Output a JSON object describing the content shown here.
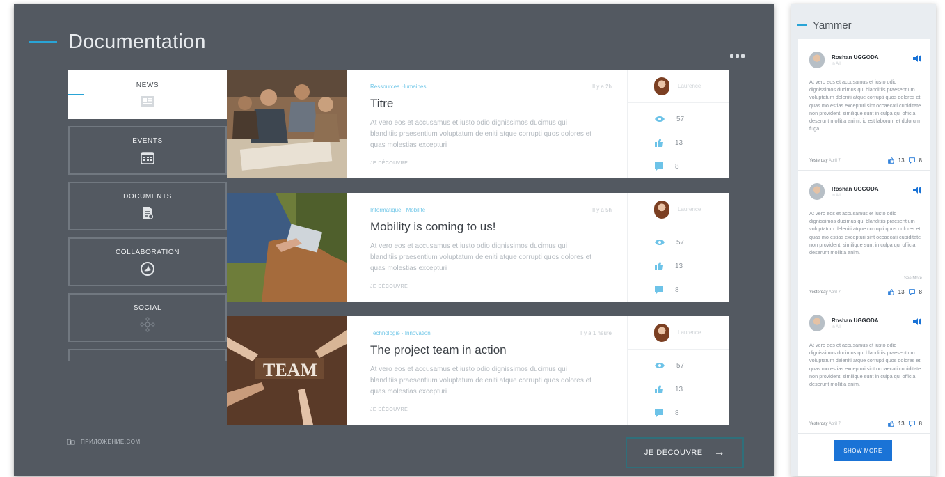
{
  "main": {
    "title": "Documentation",
    "more_icon": "more-dots-icon"
  },
  "nav": [
    {
      "label": "NEWS",
      "icon": "news-icon",
      "active": true
    },
    {
      "label": "EVENTS",
      "icon": "calendar-icon",
      "active": false
    },
    {
      "label": "DOCUMENTS",
      "icon": "document-icon",
      "active": false
    },
    {
      "label": "COLLABORATION",
      "icon": "collaboration-icon",
      "active": false
    },
    {
      "label": "SOCIAL",
      "icon": "social-icon",
      "active": false
    }
  ],
  "footer": {
    "label": "ПРИЛОЖЕНИЕ.COM"
  },
  "cards": [
    {
      "category": "Ressources Humaines",
      "time": "Il y a 2h",
      "title": "Titre",
      "excerpt": "At vero eos et accusamus et iusto odio dignissimos ducimus qui blanditiis praesentium voluptatum deleniti atque corrupti quos dolores et quas molestias excepturi",
      "more": "JE DÉCOUVRE",
      "author": "Laurence",
      "views": "57",
      "likes": "13",
      "comments": "8"
    },
    {
      "category": "Informatique · Mobilité",
      "time": "Il y a 5h",
      "title": "Mobility is coming to us!",
      "excerpt": "At vero eos et accusamus et iusto odio dignissimos ducimus qui blanditiis praesentium voluptatum deleniti atque corrupti quos dolores et quas molestias excepturi",
      "more": "JE DÉCOUVRE",
      "author": "Laurence",
      "views": "57",
      "likes": "13",
      "comments": "8"
    },
    {
      "category": "Technologie · Innovation",
      "time": "Il y a 1 heure",
      "title": "The project team in action",
      "excerpt": "At vero eos et accusamus et iusto odio dignissimos ducimus qui blanditiis praesentium voluptatum deleniti atque corrupti quos dolores et quas molestias excepturi",
      "more": "JE DÉCOUVRE",
      "author": "Laurence",
      "views": "57",
      "likes": "13",
      "comments": "8"
    }
  ],
  "cta": {
    "label": "JE DÉCOUVRE",
    "arrow": "→"
  },
  "yammer": {
    "title": "Yammer",
    "posts": [
      {
        "name": "Roshan UGGODA",
        "sub": "in All",
        "text": "At vero eos et accusamus et iusto odio dignissimos ducimus qui blanditiis praesentium voluptatum deleniti atque corrupti quos dolores et quas mo estias excepturi sint occaecati cupiditate non provident, similique sunt in culpa qui officia deserunt mollitia animi, id est laborum et dolorum fuga.",
        "date_day": "Yesterday",
        "date_rest": "April 7",
        "likes": "13",
        "comments": "8",
        "see_more": ""
      },
      {
        "name": "Roshan UGGODA",
        "sub": "in All",
        "text": "At vero eos et accusamus et iusto odio dignissimos ducimus qui blanditiis praesentium voluptatum deleniti atque corrupti quos dolores et quas mo estias excepturi sint occaecati cupiditate non provident, similique sunt in culpa qui officia deserunt mollitia anim.",
        "date_day": "Yesterday",
        "date_rest": "April 7",
        "likes": "13",
        "comments": "8",
        "see_more": "See More"
      },
      {
        "name": "Roshan UGGODA",
        "sub": "in All",
        "text": "At vero eos et accusamus et iusto odio dignissimos ducimus qui blanditiis praesentium voluptatum deleniti atque corrupti quos dolores et quas mo estias excepturi sint occaecati cupiditate non provident, similique sunt in culpa qui officia deserunt mollitia anim.",
        "date_day": "Yesterday",
        "date_rest": "April 7",
        "likes": "13",
        "comments": "8",
        "see_more": ""
      }
    ],
    "show_more": "SHOW MORE"
  },
  "colors": {
    "accent": "#29a4d6",
    "panel": "#535961",
    "yammer_button": "#1a73d6"
  }
}
